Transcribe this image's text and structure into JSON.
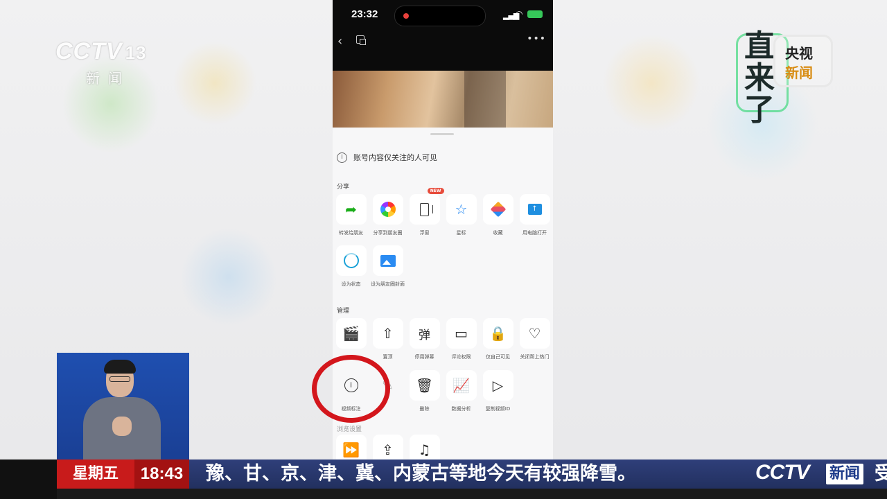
{
  "broadcast": {
    "channel_logo": {
      "brand": "CCTV",
      "number": "13",
      "subtitle": "新闻"
    },
    "live_logo": {
      "big": "直来了",
      "line1": "央视",
      "line2": "新闻"
    },
    "ticker": {
      "day": "星期五",
      "time": "18:43",
      "headline": "豫、甘、京、津、冀、内蒙古等地今天有较强降雪。",
      "brand": "CCTV",
      "brand_tag": "新闻",
      "trailing": "受"
    }
  },
  "phone": {
    "status_bar": {
      "time": "23:32"
    },
    "notice": "账号内容仅关注的人可见",
    "sections": {
      "share": {
        "title": "分享",
        "items": [
          {
            "label": "转发给朋友",
            "icon": "share-arrow-icon"
          },
          {
            "label": "分享到朋友圈",
            "icon": "moments-camera-icon"
          },
          {
            "label": "浮窗",
            "icon": "float-window-icon",
            "badge": "NEW"
          },
          {
            "label": "星标",
            "icon": "star-icon"
          },
          {
            "label": "收藏",
            "icon": "favorite-cube-icon"
          },
          {
            "label": "用电脑打开",
            "icon": "monitor-icon"
          },
          {
            "label": "设为状态",
            "icon": "status-ring-icon"
          },
          {
            "label": "设为朋友圈封面",
            "icon": "cover-image-icon"
          }
        ]
      },
      "manage": {
        "title": "管理",
        "items": [
          {
            "label": "",
            "icon": "clapper-icon"
          },
          {
            "label": "置顶",
            "icon": "pin-top-icon"
          },
          {
            "label": "停用弹幕",
            "icon": "danmaku-icon",
            "glyph": "弹"
          },
          {
            "label": "评论权限",
            "icon": "comment-permission-icon"
          },
          {
            "label": "仅自己可见",
            "icon": "lock-icon"
          },
          {
            "label": "关闭帮上热门",
            "icon": "heart-lock-icon"
          },
          {
            "label": "视频标注",
            "icon": "info-icon"
          },
          {
            "label": "",
            "icon": "pen-icon"
          },
          {
            "label": "删除",
            "icon": "trash-icon"
          },
          {
            "label": "数据分析",
            "icon": "chart-icon"
          },
          {
            "label": "复制视频ID",
            "icon": "video-id-icon"
          }
        ]
      },
      "more": {
        "title": "浏览设置",
        "items": [
          {
            "icon": "forward-play-icon"
          },
          {
            "icon": "upload-icon"
          },
          {
            "icon": "music-icon"
          }
        ]
      }
    }
  }
}
